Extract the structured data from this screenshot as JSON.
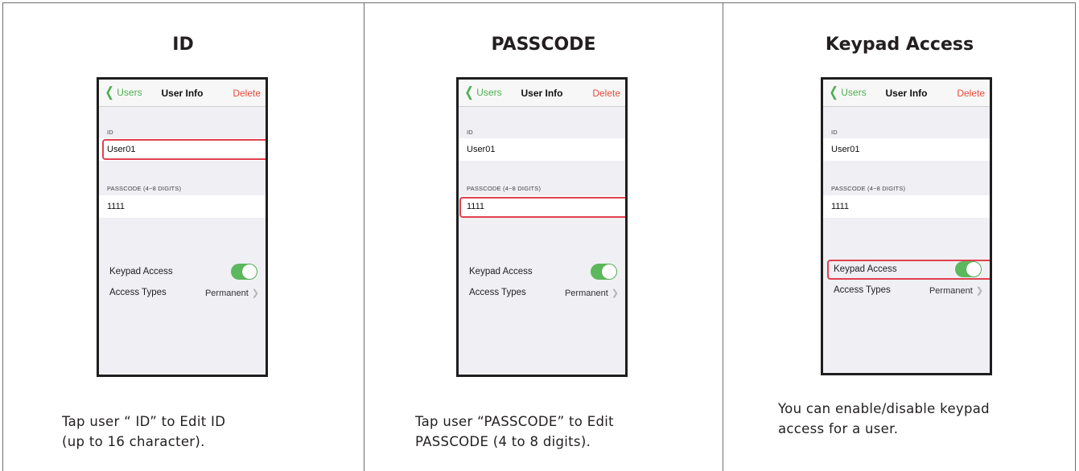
{
  "columns": [
    {
      "title": "ID",
      "caption_line1": "Tap user “ ID” to Edit ID",
      "caption_line2": "(up to 16 character).",
      "highlight": "id"
    },
    {
      "title": "PASSCODE",
      "caption_line1": "Tap user “PASSCODE” to Edit",
      "caption_line2": "PASSCODE (4 to 8 digits).",
      "highlight": "passcode"
    },
    {
      "title": "Keypad Access",
      "caption_line1": "You can enable/disable keypad",
      "caption_line2": "access for a user.",
      "highlight": "keypad"
    }
  ],
  "phone": {
    "back_label": "Users",
    "nav_title": "User Info",
    "delete_label": "Delete",
    "id_section_label": "ID",
    "id_value": "User01",
    "passcode_section_label": "PASSCODE (4~8 DIGITS)",
    "passcode_value": "1111",
    "keypad_access_label": "Keypad Access",
    "keypad_access_enabled": true,
    "access_types_label": "Access Types",
    "access_types_value": "Permanent"
  },
  "colors": {
    "accent_green": "#4caf50",
    "delete_red": "#e74c3c",
    "highlight_red": "#e0414e",
    "toggle_green": "#5cb85c"
  },
  "icons": [
    "chevron-left-icon",
    "chevron-right-icon",
    "toggle-switch"
  ]
}
